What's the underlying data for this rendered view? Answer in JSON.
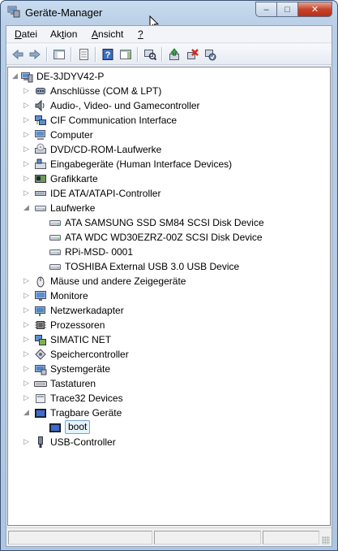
{
  "window": {
    "title": "Geräte-Manager",
    "minimize_glyph": "‒",
    "maximize_glyph": "□",
    "close_glyph": "✕"
  },
  "menu": [
    {
      "pre": "",
      "u": "D",
      "post": "atei"
    },
    {
      "pre": "Ak",
      "u": "t",
      "post": "ion"
    },
    {
      "pre": "",
      "u": "A",
      "post": "nsicht"
    },
    {
      "pre": "",
      "u": "?",
      "post": ""
    }
  ],
  "toolbar": {
    "buttons": [
      "back-icon",
      "forward-icon",
      "show-hide-tree-icon",
      "properties-icon",
      "help-icon",
      "action-pane-icon",
      "scan-hardware-icon",
      "update-driver-icon",
      "uninstall-icon",
      "disable-icon"
    ]
  },
  "tree": {
    "root": "DE-3JDYV42-P",
    "nodes": [
      {
        "label": "Anschlüsse (COM & LPT)",
        "icon": "port-icon",
        "state": "collapsed",
        "level": 1
      },
      {
        "label": "Audio-, Video- und Gamecontroller",
        "icon": "speaker-icon",
        "state": "collapsed",
        "level": 1
      },
      {
        "label": "CIF Communication Interface",
        "icon": "network-card-icon",
        "state": "collapsed",
        "level": 1
      },
      {
        "label": "Computer",
        "icon": "computer-icon",
        "state": "collapsed",
        "level": 1
      },
      {
        "label": "DVD/CD-ROM-Laufwerke",
        "icon": "dvd-drive-icon",
        "state": "collapsed",
        "level": 1
      },
      {
        "label": "Eingabegeräte (Human Interface Devices)",
        "icon": "hid-icon",
        "state": "collapsed",
        "level": 1
      },
      {
        "label": "Grafikkarte",
        "icon": "display-adapter-icon",
        "state": "collapsed",
        "level": 1
      },
      {
        "label": "IDE ATA/ATAPI-Controller",
        "icon": "ide-controller-icon",
        "state": "collapsed",
        "level": 1
      },
      {
        "label": "Laufwerke",
        "icon": "disk-drive-icon",
        "state": "expanded",
        "level": 1
      },
      {
        "label": "ATA SAMSUNG SSD SM84 SCSI Disk Device",
        "icon": "disk-drive-icon",
        "state": "leaf",
        "level": 2
      },
      {
        "label": "ATA WDC WD30EZRZ-00Z SCSI Disk Device",
        "icon": "disk-drive-icon",
        "state": "leaf",
        "level": 2
      },
      {
        "label": "RPi-MSD- 0001",
        "icon": "disk-drive-icon",
        "state": "leaf",
        "level": 2
      },
      {
        "label": "TOSHIBA External USB 3.0 USB Device",
        "icon": "disk-drive-icon",
        "state": "leaf",
        "level": 2
      },
      {
        "label": "Mäuse und andere Zeigegeräte",
        "icon": "mouse-icon",
        "state": "collapsed",
        "level": 1
      },
      {
        "label": "Monitore",
        "icon": "monitor-icon",
        "state": "collapsed",
        "level": 1
      },
      {
        "label": "Netzwerkadapter",
        "icon": "network-adapter-icon",
        "state": "collapsed",
        "level": 1
      },
      {
        "label": "Prozessoren",
        "icon": "processor-icon",
        "state": "collapsed",
        "level": 1
      },
      {
        "label": "SIMATIC NET",
        "icon": "simatic-net-icon",
        "state": "collapsed",
        "level": 1
      },
      {
        "label": "Speichercontroller",
        "icon": "storage-controller-icon",
        "state": "collapsed",
        "level": 1
      },
      {
        "label": "Systemgeräte",
        "icon": "system-device-icon",
        "state": "collapsed",
        "level": 1
      },
      {
        "label": "Tastaturen",
        "icon": "keyboard-icon",
        "state": "collapsed",
        "level": 1
      },
      {
        "label": "Trace32 Devices",
        "icon": "trace32-icon",
        "state": "collapsed",
        "level": 1
      },
      {
        "label": "Tragbare Geräte",
        "icon": "portable-device-icon",
        "state": "expanded",
        "level": 1
      },
      {
        "label": "boot",
        "icon": "portable-device-icon",
        "state": "leaf",
        "level": 2,
        "selected": true
      },
      {
        "label": "USB-Controller",
        "icon": "usb-icon",
        "state": "collapsed",
        "level": 1
      }
    ]
  },
  "colors": {
    "selection_bg": "#e5f3fb",
    "selection_border": "#7da2ce",
    "titlebar": "#b9cfe6",
    "close_button": "#c7432a"
  }
}
